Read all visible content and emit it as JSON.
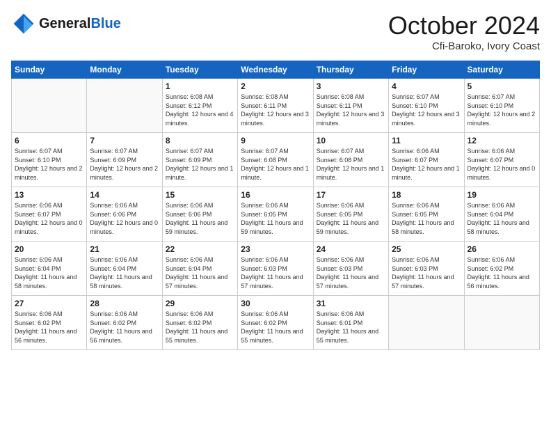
{
  "header": {
    "logo_line1": "General",
    "logo_line2": "Blue",
    "month": "October 2024",
    "location": "Cfi-Baroko, Ivory Coast"
  },
  "weekdays": [
    "Sunday",
    "Monday",
    "Tuesday",
    "Wednesday",
    "Thursday",
    "Friday",
    "Saturday"
  ],
  "weeks": [
    [
      {
        "day": "",
        "info": ""
      },
      {
        "day": "",
        "info": ""
      },
      {
        "day": "1",
        "info": "Sunrise: 6:08 AM\nSunset: 6:12 PM\nDaylight: 12 hours and 4 minutes."
      },
      {
        "day": "2",
        "info": "Sunrise: 6:08 AM\nSunset: 6:11 PM\nDaylight: 12 hours and 3 minutes."
      },
      {
        "day": "3",
        "info": "Sunrise: 6:08 AM\nSunset: 6:11 PM\nDaylight: 12 hours and 3 minutes."
      },
      {
        "day": "4",
        "info": "Sunrise: 6:07 AM\nSunset: 6:10 PM\nDaylight: 12 hours and 3 minutes."
      },
      {
        "day": "5",
        "info": "Sunrise: 6:07 AM\nSunset: 6:10 PM\nDaylight: 12 hours and 2 minutes."
      }
    ],
    [
      {
        "day": "6",
        "info": "Sunrise: 6:07 AM\nSunset: 6:10 PM\nDaylight: 12 hours and 2 minutes."
      },
      {
        "day": "7",
        "info": "Sunrise: 6:07 AM\nSunset: 6:09 PM\nDaylight: 12 hours and 2 minutes."
      },
      {
        "day": "8",
        "info": "Sunrise: 6:07 AM\nSunset: 6:09 PM\nDaylight: 12 hours and 1 minute."
      },
      {
        "day": "9",
        "info": "Sunrise: 6:07 AM\nSunset: 6:08 PM\nDaylight: 12 hours and 1 minute."
      },
      {
        "day": "10",
        "info": "Sunrise: 6:07 AM\nSunset: 6:08 PM\nDaylight: 12 hours and 1 minute."
      },
      {
        "day": "11",
        "info": "Sunrise: 6:06 AM\nSunset: 6:07 PM\nDaylight: 12 hours and 1 minute."
      },
      {
        "day": "12",
        "info": "Sunrise: 6:06 AM\nSunset: 6:07 PM\nDaylight: 12 hours and 0 minutes."
      }
    ],
    [
      {
        "day": "13",
        "info": "Sunrise: 6:06 AM\nSunset: 6:07 PM\nDaylight: 12 hours and 0 minutes."
      },
      {
        "day": "14",
        "info": "Sunrise: 6:06 AM\nSunset: 6:06 PM\nDaylight: 12 hours and 0 minutes."
      },
      {
        "day": "15",
        "info": "Sunrise: 6:06 AM\nSunset: 6:06 PM\nDaylight: 11 hours and 59 minutes."
      },
      {
        "day": "16",
        "info": "Sunrise: 6:06 AM\nSunset: 6:05 PM\nDaylight: 11 hours and 59 minutes."
      },
      {
        "day": "17",
        "info": "Sunrise: 6:06 AM\nSunset: 6:05 PM\nDaylight: 11 hours and 59 minutes."
      },
      {
        "day": "18",
        "info": "Sunrise: 6:06 AM\nSunset: 6:05 PM\nDaylight: 11 hours and 58 minutes."
      },
      {
        "day": "19",
        "info": "Sunrise: 6:06 AM\nSunset: 6:04 PM\nDaylight: 11 hours and 58 minutes."
      }
    ],
    [
      {
        "day": "20",
        "info": "Sunrise: 6:06 AM\nSunset: 6:04 PM\nDaylight: 11 hours and 58 minutes."
      },
      {
        "day": "21",
        "info": "Sunrise: 6:06 AM\nSunset: 6:04 PM\nDaylight: 11 hours and 58 minutes."
      },
      {
        "day": "22",
        "info": "Sunrise: 6:06 AM\nSunset: 6:04 PM\nDaylight: 11 hours and 57 minutes."
      },
      {
        "day": "23",
        "info": "Sunrise: 6:06 AM\nSunset: 6:03 PM\nDaylight: 11 hours and 57 minutes."
      },
      {
        "day": "24",
        "info": "Sunrise: 6:06 AM\nSunset: 6:03 PM\nDaylight: 11 hours and 57 minutes."
      },
      {
        "day": "25",
        "info": "Sunrise: 6:06 AM\nSunset: 6:03 PM\nDaylight: 11 hours and 57 minutes."
      },
      {
        "day": "26",
        "info": "Sunrise: 6:06 AM\nSunset: 6:02 PM\nDaylight: 11 hours and 56 minutes."
      }
    ],
    [
      {
        "day": "27",
        "info": "Sunrise: 6:06 AM\nSunset: 6:02 PM\nDaylight: 11 hours and 56 minutes."
      },
      {
        "day": "28",
        "info": "Sunrise: 6:06 AM\nSunset: 6:02 PM\nDaylight: 11 hours and 56 minutes."
      },
      {
        "day": "29",
        "info": "Sunrise: 6:06 AM\nSunset: 6:02 PM\nDaylight: 11 hours and 55 minutes."
      },
      {
        "day": "30",
        "info": "Sunrise: 6:06 AM\nSunset: 6:02 PM\nDaylight: 11 hours and 55 minutes."
      },
      {
        "day": "31",
        "info": "Sunrise: 6:06 AM\nSunset: 6:01 PM\nDaylight: 11 hours and 55 minutes."
      },
      {
        "day": "",
        "info": ""
      },
      {
        "day": "",
        "info": ""
      }
    ]
  ]
}
